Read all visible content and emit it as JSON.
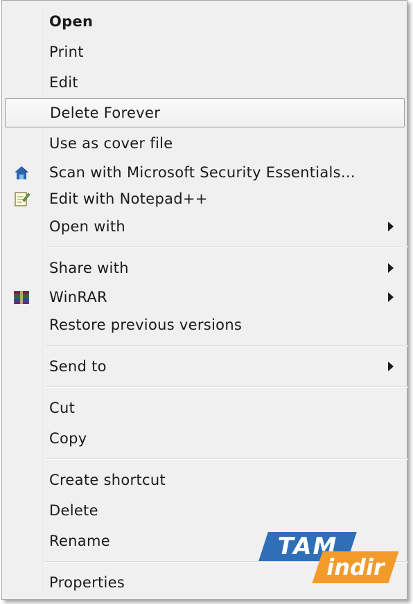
{
  "menu": {
    "items": [
      {
        "label": "Open"
      },
      {
        "label": "Print"
      },
      {
        "label": "Edit"
      },
      {
        "label": "Delete Forever"
      },
      {
        "label": "Use as cover file"
      },
      {
        "label": "Scan with Microsoft Security Essentials...",
        "icon": "shield-house-icon"
      },
      {
        "label": "Edit with Notepad++",
        "icon": "notepad-icon"
      },
      {
        "label": "Open with",
        "submenu": true
      },
      {
        "label": "Share with",
        "submenu": true
      },
      {
        "label": "WinRAR",
        "icon": "winrar-books-icon",
        "submenu": true
      },
      {
        "label": "Restore previous versions"
      },
      {
        "label": "Send to",
        "submenu": true
      },
      {
        "label": "Cut"
      },
      {
        "label": "Copy"
      },
      {
        "label": "Create shortcut"
      },
      {
        "label": "Delete"
      },
      {
        "label": "Rename"
      },
      {
        "label": "Properties"
      }
    ],
    "highlighted": "Delete Forever"
  },
  "watermark": {
    "line1": "TAM",
    "line2": "indir"
  },
  "colors": {
    "menu_bg": "#f0f0f0",
    "watermark_blue": "#2f6fb7",
    "watermark_orange": "#f39b2a"
  }
}
